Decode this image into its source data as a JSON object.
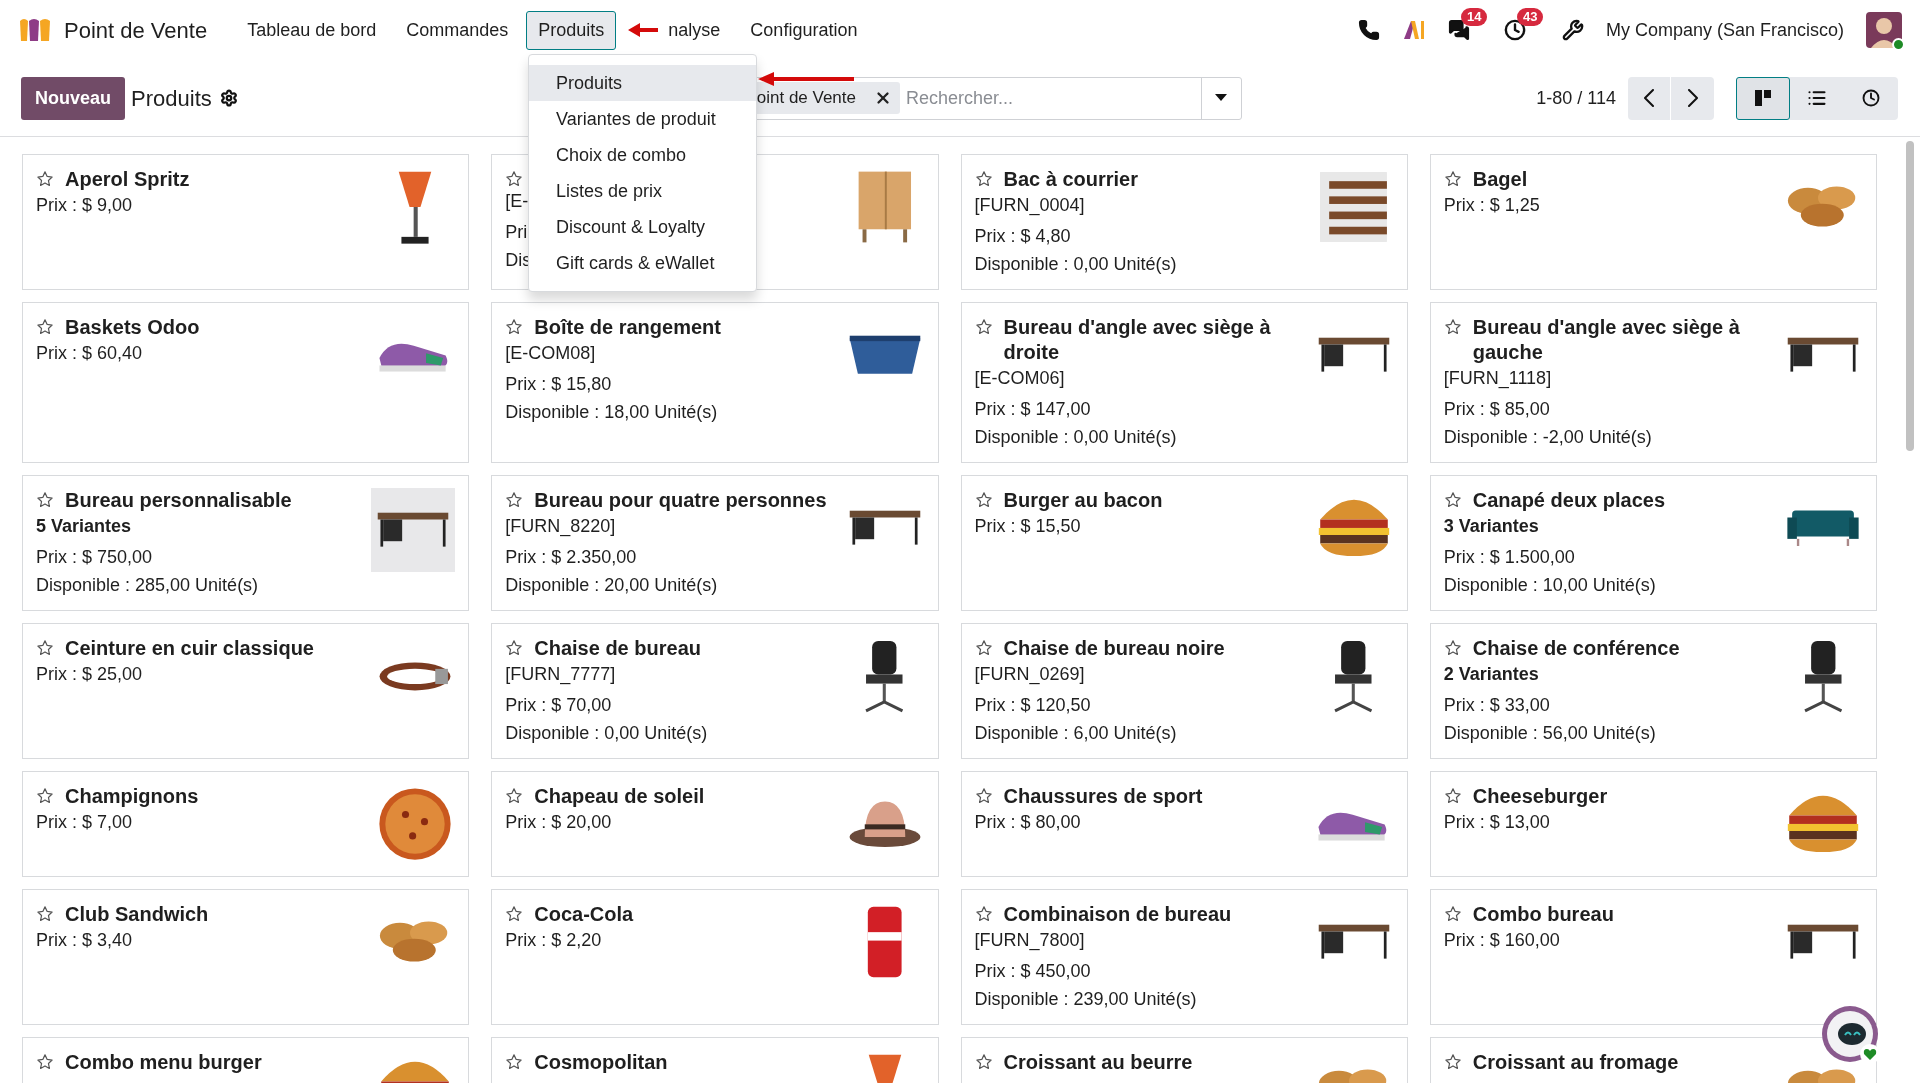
{
  "navbar": {
    "app_name": "Point de Vente",
    "menus": [
      {
        "label": "Tableau de bord",
        "selected": false
      },
      {
        "label": "Commandes",
        "selected": false
      },
      {
        "label": "Produits",
        "selected": true
      },
      {
        "label": "nalyse",
        "selected": false
      },
      {
        "label": "Configuration",
        "selected": false
      }
    ],
    "chat_badge": "14",
    "activity_badge": "43",
    "company": "My Company (San Francisco)"
  },
  "menu_dropdown": {
    "items": [
      {
        "label": "Produits",
        "selected": true
      },
      {
        "label": "Variantes de produit",
        "selected": false
      },
      {
        "label": "Choix de combo",
        "selected": false
      },
      {
        "label": "Listes de prix",
        "selected": false
      },
      {
        "label": "Discount & Loyalty",
        "selected": false
      },
      {
        "label": "Gift cards & eWallet",
        "selected": false
      }
    ]
  },
  "control_panel": {
    "new_button": "Nouveau",
    "title": "Produits",
    "search": {
      "facet": "oint de Vente",
      "placeholder": "Rechercher..."
    },
    "pager": "1-80 / 114",
    "views": [
      {
        "kind": "kanban",
        "selected": true
      },
      {
        "kind": "list",
        "selected": false
      },
      {
        "kind": "activity",
        "selected": false
      }
    ]
  },
  "products": [
    {
      "name": "Aperol Spritz",
      "price": "Prix : $ 9,00",
      "favorite": false
    },
    {
      "ref": "[E-",
      "price": "Pri",
      "available": "Dis",
      "favorite": false
    },
    {
      "name": "Bac à courrier",
      "ref": "[FURN_0004]",
      "price": "Prix : $ 4,80",
      "available": "Disponible : 0,00 Unité(s)",
      "favorite": false
    },
    {
      "name": "Bagel",
      "price": "Prix : $ 1,25",
      "favorite": false
    },
    {
      "name": "Baskets Odoo",
      "price": "Prix : $ 60,40",
      "favorite": false
    },
    {
      "name": "Boîte de rangement",
      "ref": "[E-COM08]",
      "price": "Prix : $ 15,80",
      "available": "Disponible : 18,00 Unité(s)",
      "favorite": false
    },
    {
      "name": "Bureau d'angle avec siège à droite",
      "ref": "[E-COM06]",
      "price": "Prix : $ 147,00",
      "available": "Disponible : 0,00 Unité(s)",
      "favorite": false
    },
    {
      "name": "Bureau d'angle avec siège à gauche",
      "ref": "[FURN_1118]",
      "price": "Prix : $ 85,00",
      "available": "Disponible : -2,00 Unité(s)",
      "favorite": false
    },
    {
      "name": "Bureau personnalisable",
      "variants": "5 Variantes",
      "price": "Prix : $ 750,00",
      "available": "Disponible : 285,00 Unité(s)",
      "favorite": false
    },
    {
      "name": "Bureau pour quatre personnes",
      "ref": "[FURN_8220]",
      "price": "Prix : $ 2.350,00",
      "available": "Disponible : 20,00 Unité(s)",
      "favorite": false
    },
    {
      "name": "Burger au bacon",
      "price": "Prix : $ 15,50",
      "favorite": false
    },
    {
      "name": "Canapé deux places",
      "variants": "3 Variantes",
      "price": "Prix : $ 1.500,00",
      "available": "Disponible : 10,00 Unité(s)",
      "favorite": false
    },
    {
      "name": "Ceinture en cuir classique",
      "price": "Prix : $ 25,00",
      "favorite": false
    },
    {
      "name": "Chaise de bureau",
      "ref": "[FURN_7777]",
      "price": "Prix : $ 70,00",
      "available": "Disponible : 0,00 Unité(s)",
      "favorite": false
    },
    {
      "name": "Chaise de bureau noire",
      "ref": "[FURN_0269]",
      "price": "Prix : $ 120,50",
      "available": "Disponible : 6,00 Unité(s)",
      "favorite": false
    },
    {
      "name": "Chaise de conférence",
      "variants": "2 Variantes",
      "price": "Prix : $ 33,00",
      "available": "Disponible : 56,00 Unité(s)",
      "favorite": false
    },
    {
      "name": "Champignons",
      "price": "Prix : $ 7,00",
      "favorite": false
    },
    {
      "name": "Chapeau de soleil",
      "price": "Prix : $ 20,00",
      "favorite": false
    },
    {
      "name": "Chaussures de sport",
      "price": "Prix : $ 80,00",
      "favorite": false
    },
    {
      "name": "Cheeseburger",
      "price": "Prix : $ 13,00",
      "favorite": false
    },
    {
      "name": "Club Sandwich",
      "price": "Prix : $ 3,40",
      "favorite": false
    },
    {
      "name": "Coca-Cola",
      "price": "Prix : $ 2,20",
      "favorite": false
    },
    {
      "name": "Combinaison de bureau",
      "ref": "[FURN_7800]",
      "price": "Prix : $ 450,00",
      "available": "Disponible : 239,00 Unité(s)",
      "favorite": false
    },
    {
      "name": "Combo bureau",
      "price": "Prix : $ 160,00",
      "favorite": false
    },
    {
      "name": "Combo menu burger",
      "favorite": false
    },
    {
      "name": "Cosmopolitan",
      "favorite": false
    },
    {
      "name": "Croissant au beurre",
      "favorite": false
    },
    {
      "name": "Croissant au fromage",
      "favorite": false
    }
  ]
}
